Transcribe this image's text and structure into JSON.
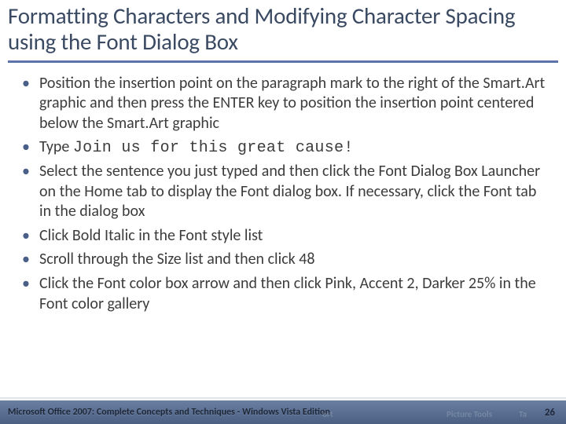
{
  "title": "Formatting Characters and Modifying Character Spacing using the Font Dialog Box",
  "bullets": [
    {
      "pre": "Position the insertion point on the paragraph mark to the right of the Smart.Art graphic and then press the ENTER key to position the insertion point centered below the Smart.Art graphic",
      "mono": "",
      "post": ""
    },
    {
      "pre": "Type ",
      "mono": "Join us for this great cause!",
      "post": ""
    },
    {
      "pre": "Select the sentence you just typed and then click the Font Dialog Box Launcher on the Home tab to display the Font dialog box. If necessary, click the Font tab in the dialog box",
      "mono": "",
      "post": ""
    },
    {
      "pre": "Click Bold Italic in the Font style list",
      "mono": "",
      "post": ""
    },
    {
      "pre": "Scroll through the Size list and then click 48",
      "mono": "",
      "post": ""
    },
    {
      "pre": "Click the Font color box arrow and then click Pink, Accent 2, Darker 25% in the Font color gallery",
      "mono": "",
      "post": ""
    }
  ],
  "footer": {
    "left": "Microsoft Office 2007: Complete Concepts and Techniques - Windows Vista Edition",
    "page": "26",
    "ghost_a": "ort",
    "ghost_b": "Picture Tools",
    "ghost_c": "Ta"
  }
}
